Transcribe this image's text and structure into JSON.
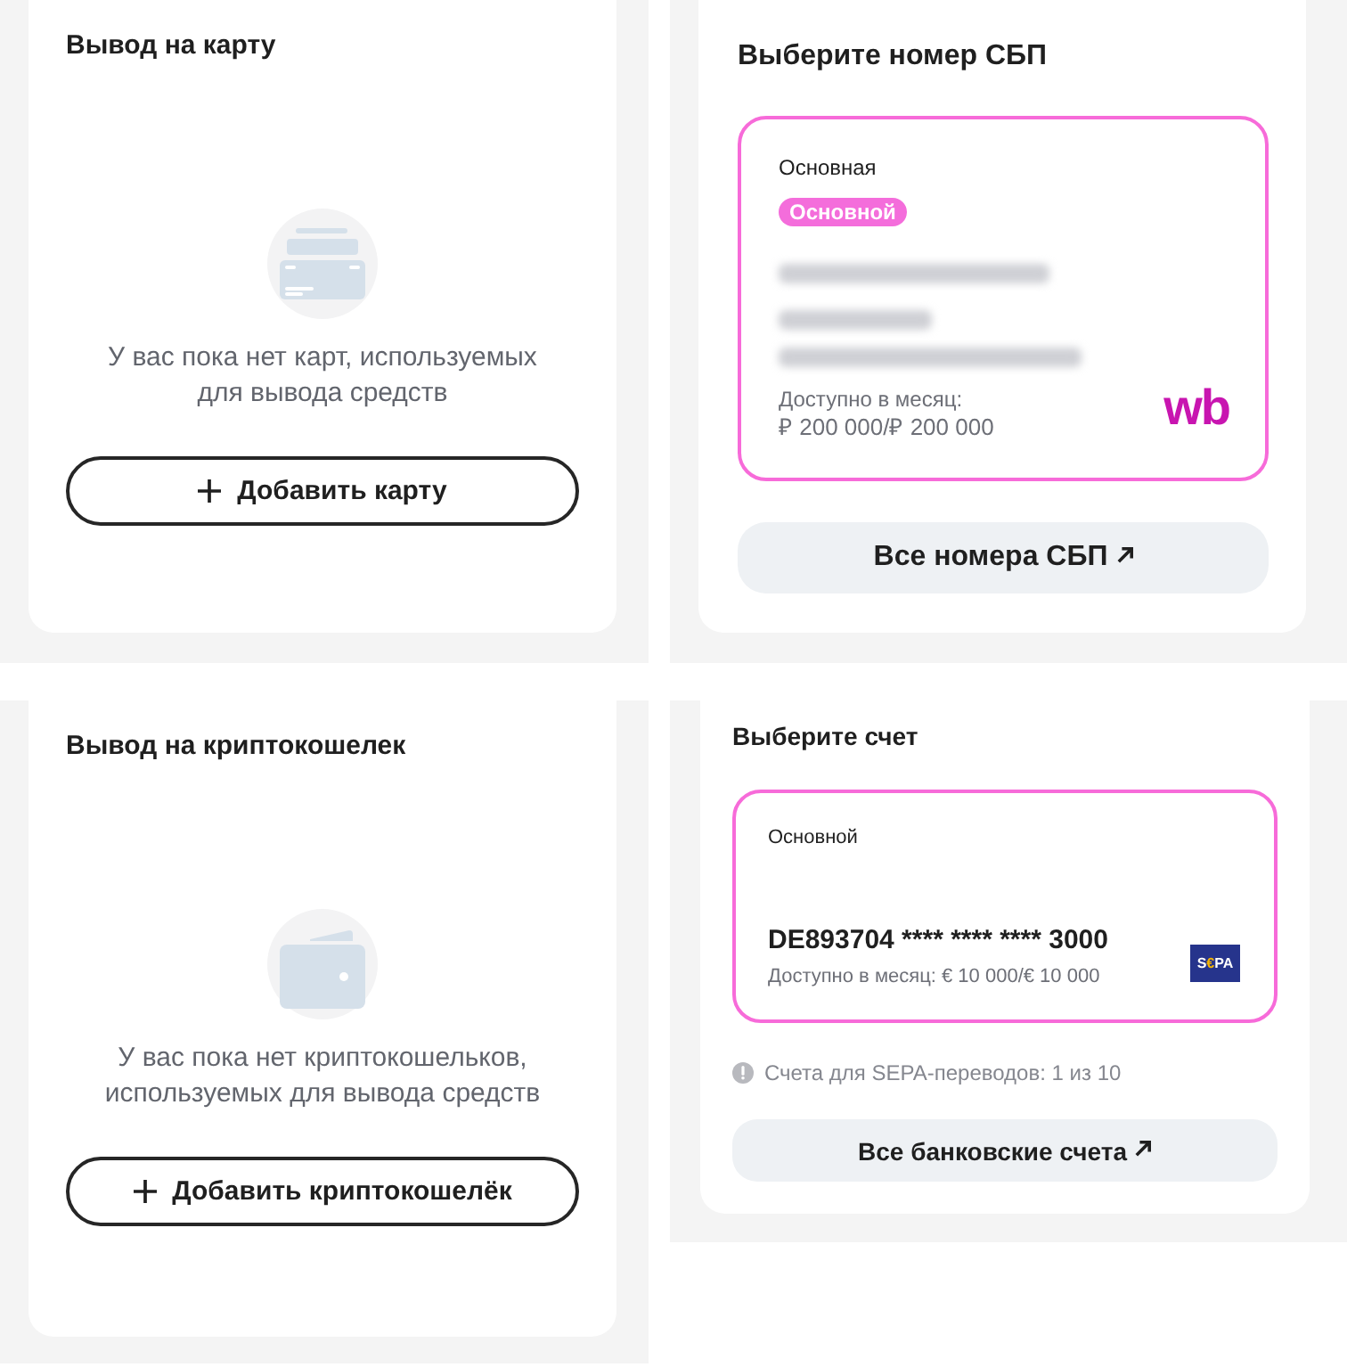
{
  "rows": [
    {
      "panels": [
        {
          "kind": "cards",
          "title": "Вывод на карту",
          "message_lines": [
            "У вас пока нет карт, используемых",
            "для вывода средств"
          ],
          "button": "Добавить карту"
        },
        {
          "kind": "sbp",
          "title": "Выберите номер СБП",
          "account": {
            "selected": true,
            "name": "Основная",
            "badge": "Основной",
            "limit_label": "Доступно в месяц:",
            "limit_value": "₽ 200 000/₽ 200 000",
            "logo": "wb"
          },
          "button": "Все номера СБП"
        }
      ]
    },
    {
      "panels": [
        {
          "kind": "wallets",
          "title": "Вывод на криптокошелек",
          "message_lines": [
            "У вас пока нет криптокошельков,",
            "используемых для вывода средств"
          ],
          "button": "Добавить криптокошелёк"
        },
        {
          "kind": "accounts",
          "title": "Выберите счет",
          "account": {
            "selected": true,
            "name": "Основной",
            "number": "DE893704 **** **** **** 3000",
            "limit": "Доступно в месяц: € 10 000/€ 10 000",
            "logo_parts": [
              "S",
              "€",
              "PA"
            ]
          },
          "note": "Счета для SEPA-переводов: 1 из 10",
          "button": "Все банковские счета"
        }
      ]
    }
  ]
}
